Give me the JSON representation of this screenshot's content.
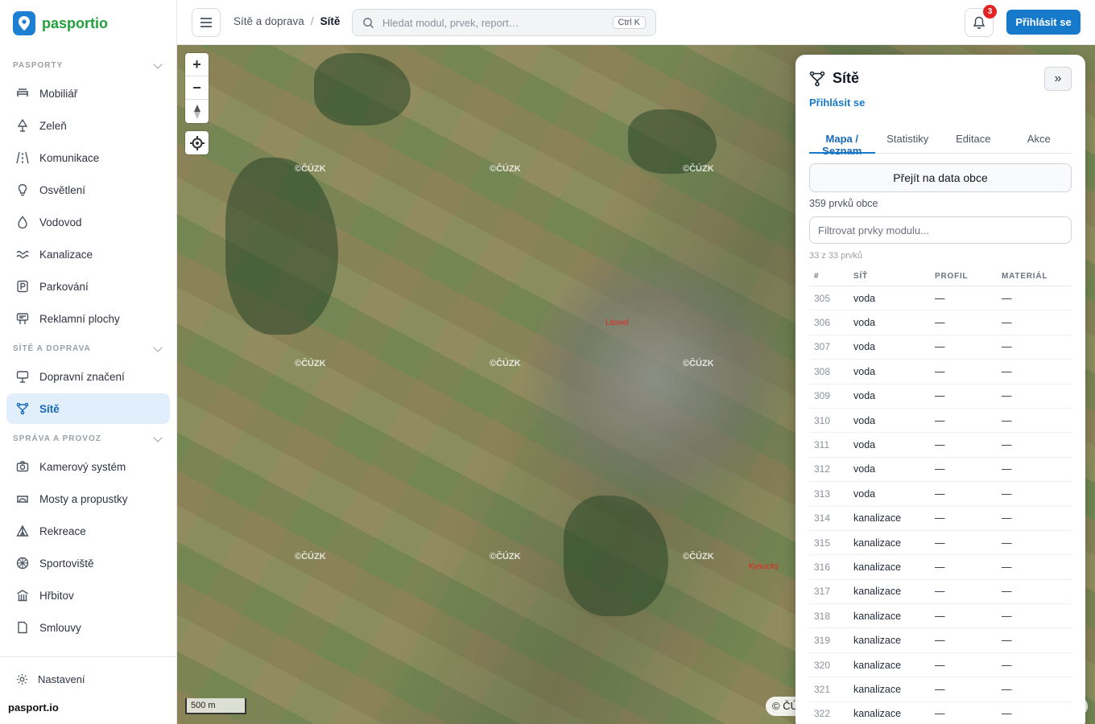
{
  "brand": {
    "name": "pasportio",
    "footer": "pasport.io"
  },
  "sidebar": {
    "sections": [
      {
        "title": "PASPORTY",
        "items": [
          {
            "label": "Mobiliář",
            "icon": "bench-icon"
          },
          {
            "label": "Zeleň",
            "icon": "tree-icon"
          },
          {
            "label": "Komunikace",
            "icon": "road-icon"
          },
          {
            "label": "Osvětlení",
            "icon": "bulb-icon"
          },
          {
            "label": "Vodovod",
            "icon": "drop-icon"
          },
          {
            "label": "Kanalizace",
            "icon": "waves-icon"
          },
          {
            "label": "Parkování",
            "icon": "parking-icon"
          },
          {
            "label": "Reklamní plochy",
            "icon": "billboard-icon"
          }
        ]
      },
      {
        "title": "SÍTĚ A DOPRAVA",
        "items": [
          {
            "label": "Dopravní značení",
            "icon": "sign-icon"
          },
          {
            "label": "Sítě",
            "icon": "network-icon",
            "active": true
          }
        ]
      },
      {
        "title": "SPRÁVA A PROVOZ",
        "items": [
          {
            "label": "Kamerový systém",
            "icon": "camera-icon"
          },
          {
            "label": "Mosty a propustky",
            "icon": "bridge-icon"
          },
          {
            "label": "Rekreace",
            "icon": "tent-icon"
          },
          {
            "label": "Sportoviště",
            "icon": "ball-icon"
          },
          {
            "label": "Hřbitov",
            "icon": "building-icon"
          },
          {
            "label": "Smlouvy",
            "icon": "document-icon"
          }
        ]
      }
    ],
    "settings_label": "Nastavení"
  },
  "topbar": {
    "breadcrumb": [
      "Sítě a doprava",
      "Sítě"
    ],
    "search_placeholder": "Hledat modul, prvek, report…",
    "shortcut": "Ctrl K",
    "notifications": "3",
    "login_label": "Přihlásit se"
  },
  "map": {
    "watermark": "©ČÚZK",
    "labels": [
      "Litovel",
      "Kysucký"
    ],
    "scale": "500 m",
    "attribution": "© ČÚ"
  },
  "panel": {
    "title": "Sítě",
    "login_link": "Přihlásit se",
    "tabs": [
      "Mapa / Seznam",
      "Statistiky",
      "Editace",
      "Akce"
    ],
    "goto_label": "Přejít na data obce",
    "count_text": "359 prvků obce",
    "filter_placeholder": "Filtrovat prvky modulu...",
    "subcount": "33 z 33 prvků",
    "columns": [
      "#",
      "SÍŤ",
      "PROFIL",
      "MATERIÁL"
    ],
    "rows": [
      [
        "305",
        "voda",
        "—",
        "—"
      ],
      [
        "306",
        "voda",
        "—",
        "—"
      ],
      [
        "307",
        "voda",
        "—",
        "—"
      ],
      [
        "308",
        "voda",
        "—",
        "—"
      ],
      [
        "309",
        "voda",
        "—",
        "—"
      ],
      [
        "310",
        "voda",
        "—",
        "—"
      ],
      [
        "311",
        "voda",
        "—",
        "—"
      ],
      [
        "312",
        "voda",
        "—",
        "—"
      ],
      [
        "313",
        "voda",
        "—",
        "—"
      ],
      [
        "314",
        "kanalizace",
        "—",
        "—"
      ],
      [
        "315",
        "kanalizace",
        "—",
        "—"
      ],
      [
        "316",
        "kanalizace",
        "—",
        "—"
      ],
      [
        "317",
        "kanalizace",
        "—",
        "—"
      ],
      [
        "318",
        "kanalizace",
        "—",
        "—"
      ],
      [
        "319",
        "kanalizace",
        "—",
        "—"
      ],
      [
        "320",
        "kanalizace",
        "—",
        "—"
      ],
      [
        "321",
        "kanalizace",
        "—",
        "—"
      ],
      [
        "322",
        "kanalizace",
        "—",
        "—"
      ]
    ]
  },
  "colors": {
    "accent": "#1679c9",
    "brand_green": "#22a03b",
    "badge": "#e02424"
  }
}
